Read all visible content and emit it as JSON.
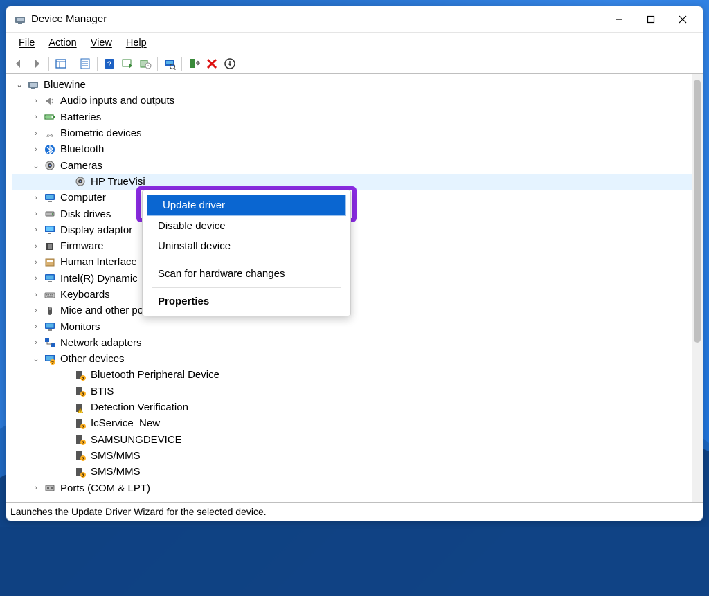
{
  "window": {
    "title": "Device Manager"
  },
  "menubar": {
    "file": "File",
    "action": "Action",
    "view": "View",
    "help": "Help"
  },
  "toolbarIcons": {
    "back": "back-arrow-icon",
    "forward": "forward-arrow-icon",
    "showhide": "show-hide-icon",
    "properties": "properties-icon",
    "help": "help-icon",
    "updatedriver": "update-driver-icon",
    "uninstall": "uninstall-icon",
    "scan": "scan-hardware-icon",
    "addlegacy": "add-legacy-icon",
    "disable": "disable-icon",
    "arrowcircle": "circled-arrow-icon"
  },
  "tree": {
    "root": "Bluewine",
    "items": [
      {
        "label": "Audio inputs and outputs",
        "icon": "speaker-icon",
        "expanded": false,
        "indent": 1,
        "chev": "closed"
      },
      {
        "label": "Batteries",
        "icon": "battery-icon",
        "expanded": false,
        "indent": 1,
        "chev": "closed"
      },
      {
        "label": "Biometric devices",
        "icon": "fingerprint-icon",
        "expanded": false,
        "indent": 1,
        "chev": "closed"
      },
      {
        "label": "Bluetooth",
        "icon": "bluetooth-icon",
        "expanded": false,
        "indent": 1,
        "chev": "closed"
      },
      {
        "label": "Cameras",
        "icon": "camera-icon",
        "expanded": true,
        "indent": 1,
        "chev": "open"
      },
      {
        "label": "HP TrueVisi",
        "icon": "camera-icon",
        "expanded": false,
        "indent": 2,
        "chev": "blank",
        "selected": true
      },
      {
        "label": "Computer",
        "icon": "monitor-icon",
        "expanded": false,
        "indent": 1,
        "chev": "closed"
      },
      {
        "label": "Disk drives",
        "icon": "disk-icon",
        "expanded": false,
        "indent": 1,
        "chev": "closed"
      },
      {
        "label": "Display adaptor",
        "icon": "display-adapter-icon",
        "expanded": false,
        "indent": 1,
        "chev": "closed"
      },
      {
        "label": "Firmware",
        "icon": "chip-icon",
        "expanded": false,
        "indent": 1,
        "chev": "closed"
      },
      {
        "label": "Human Interface",
        "icon": "hid-icon",
        "expanded": false,
        "indent": 1,
        "chev": "closed"
      },
      {
        "label": "Intel(R) Dynamic",
        "icon": "monitor-icon",
        "expanded": false,
        "indent": 1,
        "chev": "closed"
      },
      {
        "label": "Keyboards",
        "icon": "keyboard-icon",
        "expanded": false,
        "indent": 1,
        "chev": "closed"
      },
      {
        "label": "Mice and other pointing devices",
        "icon": "mouse-icon",
        "expanded": false,
        "indent": 1,
        "chev": "closed"
      },
      {
        "label": "Monitors",
        "icon": "monitor-icon",
        "expanded": false,
        "indent": 1,
        "chev": "closed"
      },
      {
        "label": "Network adapters",
        "icon": "network-icon",
        "expanded": false,
        "indent": 1,
        "chev": "closed"
      },
      {
        "label": "Other devices",
        "icon": "unknown-icon",
        "expanded": true,
        "indent": 1,
        "chev": "open"
      },
      {
        "label": "Bluetooth Peripheral Device",
        "icon": "unknown-device-icon",
        "expanded": false,
        "indent": 2,
        "chev": "blank"
      },
      {
        "label": "BTIS",
        "icon": "unknown-device-icon",
        "expanded": false,
        "indent": 2,
        "chev": "blank"
      },
      {
        "label": "Detection Verification",
        "icon": "warn-device-icon",
        "expanded": false,
        "indent": 2,
        "chev": "blank"
      },
      {
        "label": "IcService_New",
        "icon": "unknown-device-icon",
        "expanded": false,
        "indent": 2,
        "chev": "blank"
      },
      {
        "label": "SAMSUNGDEVICE",
        "icon": "unknown-device-icon",
        "expanded": false,
        "indent": 2,
        "chev": "blank"
      },
      {
        "label": "SMS/MMS",
        "icon": "unknown-device-icon",
        "expanded": false,
        "indent": 2,
        "chev": "blank"
      },
      {
        "label": "SMS/MMS",
        "icon": "unknown-device-icon",
        "expanded": false,
        "indent": 2,
        "chev": "blank"
      },
      {
        "label": "Ports (COM & LPT)",
        "icon": "port-icon",
        "expanded": false,
        "indent": 1,
        "chev": "closed"
      }
    ]
  },
  "contextMenu": {
    "updateDriver": "Update driver",
    "disableDevice": "Disable device",
    "uninstallDevice": "Uninstall device",
    "scanChanges": "Scan for hardware changes",
    "properties": "Properties"
  },
  "statusbar": {
    "text": "Launches the Update Driver Wizard for the selected device."
  },
  "colors": {
    "selection": "#0a66d1",
    "highlightBorder": "#8a2be2"
  },
  "icons": {
    "computer-icon": "🖥️",
    "speaker-icon": "🔊",
    "battery-icon": "🔋",
    "fingerprint-icon": "🖐️",
    "bluetooth-icon": "B",
    "camera-icon": "📷",
    "monitor-icon": "🖥️",
    "disk-icon": "💽",
    "display-adapter-icon": "🖥️",
    "chip-icon": "▦",
    "hid-icon": "📇",
    "keyboard-icon": "⌨️",
    "mouse-icon": "🖱️",
    "network-icon": "🖧",
    "unknown-icon": "❓",
    "unknown-device-icon": "❔",
    "warn-device-icon": "⚠️",
    "port-icon": "🖨️"
  }
}
